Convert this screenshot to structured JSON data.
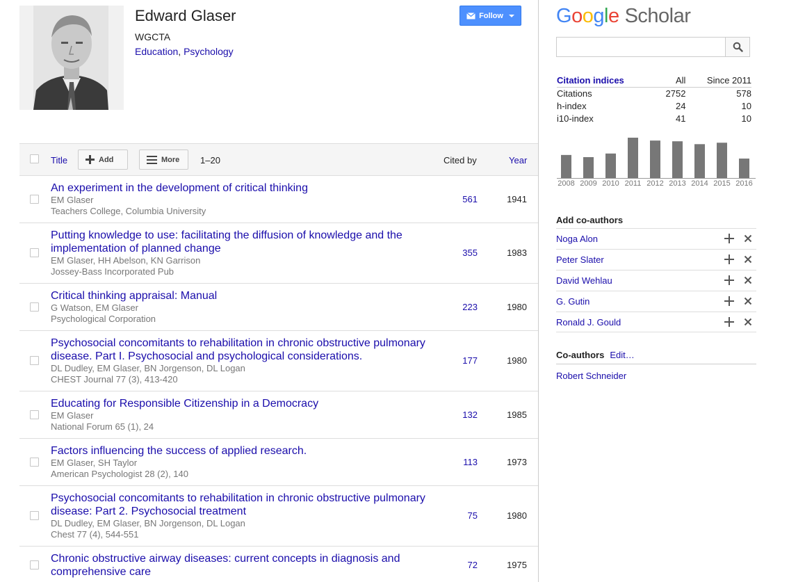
{
  "profile": {
    "name": "Edward Glaser",
    "affiliation": "WGCTA",
    "interests": [
      "Education",
      "Psychology"
    ],
    "interest_separator": ", "
  },
  "follow": {
    "label": "Follow"
  },
  "table": {
    "title_label": "Title",
    "add_label": "Add",
    "more_label": "More",
    "range": "1–20",
    "cited_by_label": "Cited by",
    "year_label": "Year",
    "rows": [
      {
        "title": "An experiment in the development of critical thinking",
        "authors": "EM Glaser",
        "venue": "Teachers College, Columbia University",
        "cites": "561",
        "year": "1941"
      },
      {
        "title": "Putting knowledge to use: facilitating the diffusion of knowledge and the implementation of planned change",
        "authors": "EM Glaser, HH Abelson, KN Garrison",
        "venue": "Jossey-Bass Incorporated Pub",
        "cites": "355",
        "year": "1983"
      },
      {
        "title": "Critical thinking appraisal: Manual",
        "authors": "G Watson, EM Glaser",
        "venue": "Psychological Corporation",
        "cites": "223",
        "year": "1980"
      },
      {
        "title": "Psychosocial concomitants to rehabilitation in chronic obstructive pulmonary disease. Part I. Psychosocial and psychological considerations.",
        "authors": "DL Dudley, EM Glaser, BN Jorgenson, DL Logan",
        "venue": "CHEST Journal 77 (3), 413-420",
        "cites": "177",
        "year": "1980"
      },
      {
        "title": "Educating for Responsible Citizenship in a Democracy",
        "authors": "EM Glaser",
        "venue": "National Forum 65 (1), 24",
        "cites": "132",
        "year": "1985"
      },
      {
        "title": "Factors influencing the success of applied research.",
        "authors": "EM Glaser, SH Taylor",
        "venue": "American Psychologist 28 (2), 140",
        "cites": "113",
        "year": "1973"
      },
      {
        "title": "Psychosocial concomitants to rehabilitation in chronic obstructive pulmonary disease: Part 2. Psychosocial treatment",
        "authors": "DL Dudley, EM Glaser, BN Jorgenson, DL Logan",
        "venue": "Chest 77 (4), 544-551",
        "cites": "75",
        "year": "1980"
      },
      {
        "title": "Chronic obstructive airway diseases: current concepts in diagnosis and comprehensive care",
        "authors": "",
        "venue": "",
        "cites": "72",
        "year": "1975"
      }
    ]
  },
  "logo": {
    "g1": "G",
    "o1": "o",
    "o2": "o",
    "g2": "g",
    "l": "l",
    "e": "e",
    "scholar": "Scholar"
  },
  "search": {
    "value": "",
    "placeholder": ""
  },
  "citations": {
    "header": [
      "Citation indices",
      "All",
      "Since 2011"
    ],
    "rows": [
      {
        "label": "Citations",
        "all": "2752",
        "since": "578"
      },
      {
        "label": "h-index",
        "all": "24",
        "since": "10"
      },
      {
        "label": "i10-index",
        "all": "41",
        "since": "10"
      }
    ]
  },
  "histogram": {
    "years": [
      "2008",
      "2009",
      "2010",
      "2011",
      "2012",
      "2013",
      "2014",
      "2015",
      "2016"
    ],
    "values": [
      32,
      29,
      34,
      56,
      52,
      51,
      47,
      49,
      27
    ],
    "max": 56,
    "bar_color": "#777777"
  },
  "add_coauthors": {
    "title": "Add co-authors",
    "items": [
      "Noga Alon",
      "Peter Slater",
      "David Wehlau",
      "G. Gutin",
      "Ronald J. Gould"
    ]
  },
  "coauthors": {
    "title": "Co-authors",
    "edit_label": "Edit…",
    "items": [
      "Robert Schneider"
    ]
  },
  "colors": {
    "link": "#1a0dab",
    "follow_button": "#4d90fe",
    "muted": "#777777"
  }
}
